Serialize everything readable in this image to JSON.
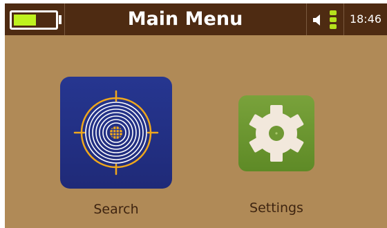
{
  "header": {
    "title": "Main Menu",
    "time": "18:46",
    "battery_level": 0.55,
    "battery_color": "#bff21e",
    "speaker_icon": "speaker-icon",
    "signal_icon": "signal-bars-icon",
    "signal_color": "#b5e11c"
  },
  "menu": {
    "items": [
      {
        "label": "Search",
        "icon": "target-icon",
        "tile_color": "#263690",
        "accent_color": "#f0a81c"
      },
      {
        "label": "Settings",
        "icon": "gear-icon",
        "tile_color": "#6f9833",
        "accent_color": "#f2e8dc"
      }
    ]
  },
  "colors": {
    "background": "#b08a57",
    "header_bar": "#4e2b12"
  }
}
